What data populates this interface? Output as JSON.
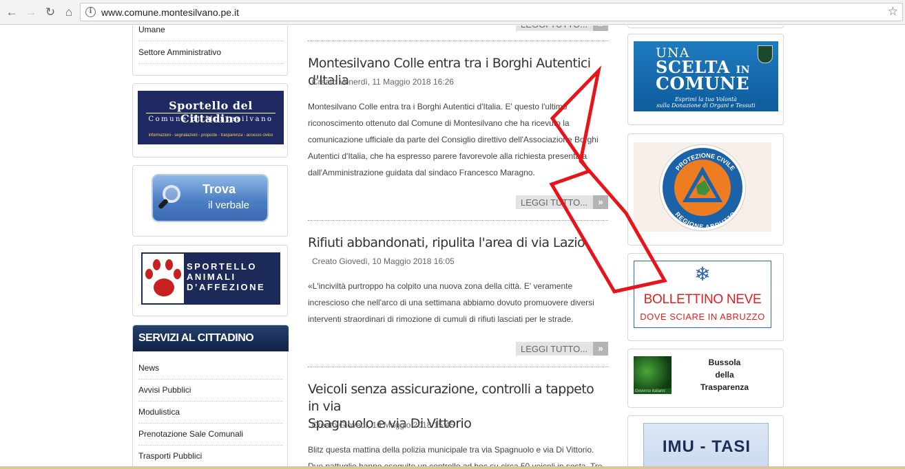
{
  "browser": {
    "url": "www.comune.montesilvano.pe.it",
    "back_icon": "back-arrow-icon",
    "forward_icon": "forward-arrow-icon",
    "reload_icon": "reload-icon",
    "home_icon": "home-icon",
    "info_icon": "site-info-icon",
    "bookmark_icon": "star-icon"
  },
  "left": {
    "top_menu": [
      "Umane",
      "Settore Amministrativo"
    ],
    "sportello_cittadino": {
      "title": "Sportello del Cittadino",
      "subtitle": "Comune di Montesilvano",
      "tags": "informazioni - segnalazioni - proposte - trasparenza - accesso civico"
    },
    "trova_verbale": {
      "line1": "Trova",
      "line2": "il verbale"
    },
    "sportello_animali": {
      "line1": "SPORTELLO",
      "line2": "ANIMALI",
      "line3": "D’AFFEZIONE"
    },
    "servizi": {
      "title": "SERVIZI AL CITTADINO",
      "items": [
        "News",
        "Avvisi Pubblici",
        "Modulistica",
        "Prenotazione Sale Comunali",
        "Trasporti Pubblici"
      ]
    }
  },
  "articles": [
    {
      "title": "Montesilvano Colle entra tra i Borghi Autentici d'Italia",
      "meta": "Creato Venerdì, 11 Maggio 2018 16:26",
      "body_lines": [
        "Montesilvano Colle entra tra i Borghi Autentici d'Italia. E' questo l'ultimo",
        "riconoscimento ottenuto dal Comune di Montesilvano che ha ricevuto la",
        "comunicazione ufficiale da parte del Consiglio direttivo dell'Associazione Borghi",
        "Autentici d'Italia, che ha espresso parere favorevole alla richiesta presentata",
        "dall'Amministrazione guidata dal sindaco Francesco Maragno."
      ]
    },
    {
      "title": "Rifiuti abbandonati, ripulita l'area di via Lazio",
      "meta": "Creato Giovedì, 10 Maggio 2018 16:05",
      "body_lines": [
        "«L'inciviltà purtroppo ha colpito una nuova zona della città. E' veramente",
        "increscioso che nell'arco di una settimana abbiamo dovuto promuovere diversi",
        "interventi straordinari di rimozione di cumuli di rifiuti lasciati per le strade."
      ]
    },
    {
      "title_lines": [
        "Veicoli senza assicurazione, controlli a tappeto in via",
        "Spagnuolo e via Di Vittorio"
      ],
      "meta": "Creato Giovedì, 10 Maggio 2018 15:45",
      "body_lines": [
        "Blitz questa mattina della polizia municipale tra via Spagnuolo e via Di Vittorio.",
        "Due pattuglie hanno eseguito un controllo ad hoc su circa 50 veicoli in sosta. Tre"
      ]
    }
  ],
  "leggi_tutto": "LEGGI TUTTO...",
  "right": {
    "scelta": {
      "line1": "UNA",
      "line2": "SCELTA",
      "line2b": "IN",
      "line3": "COMUNE",
      "line4": "Esprimi la tua Volontà",
      "line5": "sulla Donazione di Organi e Tessuti"
    },
    "protezione_civile": {
      "top": "PROTEZIONE CIVILE",
      "bottom": "REGIONE ABRUZZO"
    },
    "bollettino": {
      "icon": "snowflake-icon",
      "title": "BOLLETTINO NEVE",
      "subtitle": "DOVE SCIARE IN ABRUZZO"
    },
    "bussola": {
      "lines": [
        "Bussola",
        "della",
        "Trasparenza"
      ],
      "badge": "Governo italiano"
    },
    "imu": "IMU - TASI"
  },
  "colors": {
    "annotation": "#e8141b",
    "nav_dark": "#1f2a63",
    "accent_red": "#e21f1f"
  }
}
